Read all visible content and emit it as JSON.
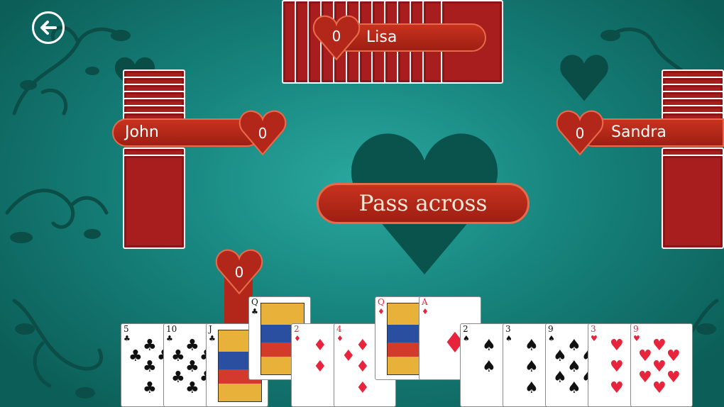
{
  "top_bar": {
    "back_button_icon": "back-arrow-icon"
  },
  "players": {
    "north": {
      "name": "Lisa",
      "score": "0"
    },
    "west": {
      "name": "John",
      "score": "0"
    },
    "east": {
      "name": "Sandra",
      "score": "0"
    },
    "south": {
      "score": "0"
    }
  },
  "center": {
    "status": "Pass across"
  },
  "hand": [
    {
      "rank": "5",
      "suit": "♣",
      "color": "black"
    },
    {
      "rank": "10",
      "suit": "♣",
      "color": "black"
    },
    {
      "rank": "J",
      "suit": "♣",
      "color": "black"
    },
    {
      "rank": "Q",
      "suit": "♣",
      "color": "black"
    },
    {
      "rank": "2",
      "suit": "♦",
      "color": "red"
    },
    {
      "rank": "4",
      "suit": "♦",
      "color": "red"
    },
    {
      "rank": "Q",
      "suit": "♦",
      "color": "red"
    },
    {
      "rank": "A",
      "suit": "♦",
      "color": "red"
    },
    {
      "rank": "2",
      "suit": "♠",
      "color": "black"
    },
    {
      "rank": "3",
      "suit": "♠",
      "color": "black"
    },
    {
      "rank": "9",
      "suit": "♠",
      "color": "black"
    },
    {
      "rank": "3",
      "suit": "♥",
      "color": "red"
    },
    {
      "rank": "9",
      "suit": "♥",
      "color": "red"
    }
  ],
  "colors": {
    "table": "#17857e",
    "accent_red": "#b3261a",
    "dark_heart": "#0b4f49"
  }
}
